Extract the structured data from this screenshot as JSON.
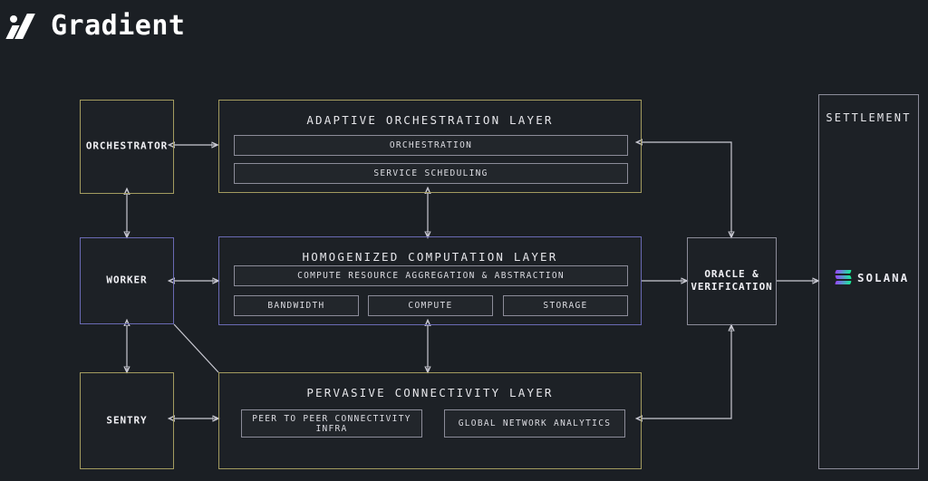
{
  "brand": {
    "name": "Gradient",
    "logo_icon": "gradient-slash-icon"
  },
  "colors": {
    "background": "#1b1f24",
    "khaki_border": "#a39b5f",
    "purple_border": "#6a6ab4",
    "gray_border": "#8c8c99",
    "text": "#e8e8ec",
    "solana_gradient_from": "#9945ff",
    "solana_gradient_to": "#14f195"
  },
  "nodes": {
    "orchestrator": {
      "label": "ORCHESTRATOR"
    },
    "worker": {
      "label": "WORKER"
    },
    "sentry": {
      "label": "SENTRY"
    },
    "oracle": {
      "label": "ORACLE &\nVERIFICATION",
      "line1": "ORACLE &",
      "line2": "VERIFICATION"
    }
  },
  "layers": {
    "orchestration": {
      "title": "ADAPTIVE ORCHESTRATION LAYER",
      "items": [
        {
          "label": "ORCHESTRATION"
        },
        {
          "label": "SERVICE SCHEDULING"
        }
      ]
    },
    "computation": {
      "title": "HOMOGENIZED COMPUTATION LAYER",
      "items": [
        {
          "label": "COMPUTE RESOURCE AGGREGATION & ABSTRACTION"
        }
      ],
      "resources": [
        {
          "label": "BANDWIDTH"
        },
        {
          "label": "COMPUTE"
        },
        {
          "label": "STORAGE"
        }
      ]
    },
    "connectivity": {
      "title": "PERVASIVE CONNECTIVITY LAYER",
      "items": [
        {
          "label": "PEER TO PEER CONNECTIVITY INFRA"
        },
        {
          "label": "GLOBAL NETWORK ANALYTICS"
        }
      ]
    }
  },
  "settlement": {
    "title": "SETTLEMENT",
    "chain": {
      "name": "SOLANA",
      "logo_icon": "solana-logo-icon"
    }
  }
}
